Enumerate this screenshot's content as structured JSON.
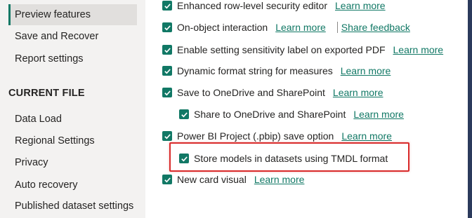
{
  "sidebar": {
    "global_items": [
      {
        "label": "Preview features",
        "selected": true
      },
      {
        "label": "Save and Recover",
        "selected": false
      },
      {
        "label": "Report settings",
        "selected": false
      }
    ],
    "current_file_heading": "CURRENT FILE",
    "current_file_items": [
      {
        "label": "Data Load"
      },
      {
        "label": "Regional Settings"
      },
      {
        "label": "Privacy"
      },
      {
        "label": "Auto recovery"
      },
      {
        "label": "Published dataset settings"
      }
    ]
  },
  "features": [
    {
      "label": "Enhanced row-level security editor",
      "checked": true,
      "link": "Learn more"
    },
    {
      "label": "On-object interaction",
      "checked": true,
      "link": "Learn more",
      "secondary_link": "Share feedback"
    },
    {
      "label": "Enable setting sensitivity label on exported PDF",
      "checked": true,
      "link": "Learn more"
    },
    {
      "label": "Dynamic format string for measures",
      "checked": true,
      "link": "Learn more"
    },
    {
      "label": "Save to OneDrive and SharePoint",
      "checked": true,
      "link": "Learn more"
    },
    {
      "label": "Share to OneDrive and SharePoint",
      "checked": true,
      "link": "Learn more"
    },
    {
      "label": "Power BI Project (.pbip) save option",
      "checked": true,
      "link": "Learn more"
    },
    {
      "label": "Store models in datasets using TMDL format",
      "checked": true,
      "link": ""
    },
    {
      "label": "New card visual",
      "checked": true,
      "link": "Learn more"
    }
  ],
  "colors": {
    "accent": "#117865",
    "highlight_border": "#d92b2b",
    "sidebar_bg": "#f3f2f1",
    "selected_bg": "#e1dfdd",
    "scrollbar": "#2b3a5c"
  },
  "icons": {
    "checkbox": "checkmark-icon"
  }
}
